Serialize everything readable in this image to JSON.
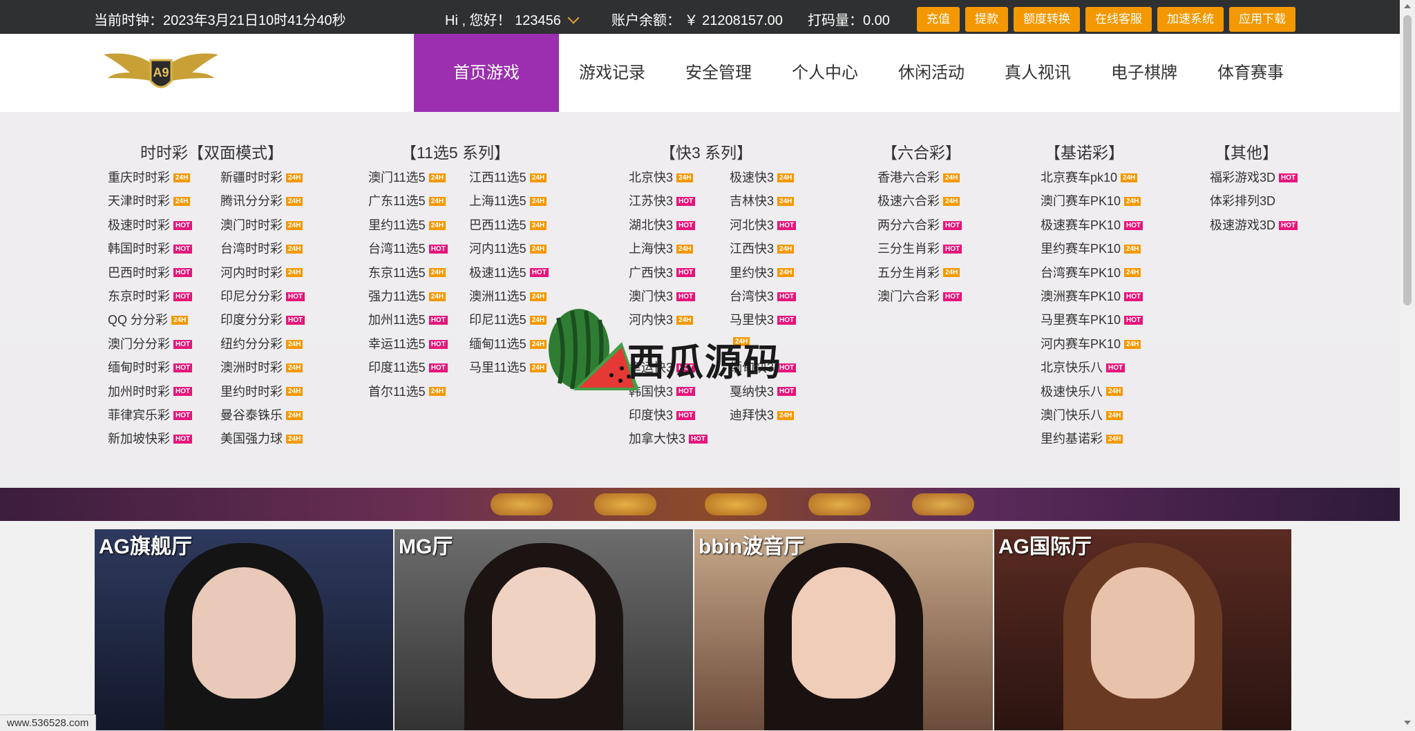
{
  "topbar": {
    "clock": "当前时钟：2023年3月21日10时41分40秒",
    "greeting": "Hi , 您好！ 123456",
    "balance": "账户余额： ￥ 21208157.00",
    "turnover": "打码量：0.00",
    "buttons": [
      "充值",
      "提款",
      "额度转换",
      "在线客服",
      "加速系统",
      "应用下载"
    ]
  },
  "nav": {
    "items": [
      "首页游戏",
      "游戏记录",
      "安全管理",
      "个人中心",
      "休闲活动",
      "真人视讯",
      "电子棋牌",
      "体育赛事"
    ],
    "active": "首页游戏"
  },
  "menu": {
    "ssc": {
      "title": "时时彩【双面模式】",
      "col1": [
        {
          "name": "重庆时时彩",
          "badge": "24H"
        },
        {
          "name": "天津时时彩",
          "badge": "24H"
        },
        {
          "name": "极速时时彩",
          "badge": "HOT"
        },
        {
          "name": "韩国时时彩",
          "badge": "HOT"
        },
        {
          "name": "巴西时时彩",
          "badge": "HOT"
        },
        {
          "name": "东京时时彩",
          "badge": "HOT"
        },
        {
          "name": "QQ 分分彩",
          "badge": "24H"
        },
        {
          "name": "澳门分分彩",
          "badge": "HOT"
        },
        {
          "name": "缅甸时时彩",
          "badge": "HOT"
        },
        {
          "name": "加州时时彩",
          "badge": "HOT"
        },
        {
          "name": "菲律宾乐彩",
          "badge": "HOT"
        },
        {
          "name": "新加坡快彩",
          "badge": "HOT"
        }
      ],
      "col2": [
        {
          "name": "新疆时时彩",
          "badge": "24H"
        },
        {
          "name": "腾讯分分彩",
          "badge": "24H"
        },
        {
          "name": "澳门时时彩",
          "badge": "24H"
        },
        {
          "name": "台湾时时彩",
          "badge": "24H"
        },
        {
          "name": "河内时时彩",
          "badge": "24H"
        },
        {
          "name": "印尼分分彩",
          "badge": "HOT"
        },
        {
          "name": "印度分分彩",
          "badge": "HOT"
        },
        {
          "name": "纽约分分彩",
          "badge": "24H"
        },
        {
          "name": "澳洲时时彩",
          "badge": "24H"
        },
        {
          "name": "里约时时彩",
          "badge": "24H"
        },
        {
          "name": "曼谷泰铢乐",
          "badge": "24H"
        },
        {
          "name": "美国强力球",
          "badge": "24H"
        }
      ]
    },
    "x115": {
      "title": "【11选5 系列】",
      "col1": [
        {
          "name": "澳门11选5",
          "badge": "24H"
        },
        {
          "name": "广东11选5",
          "badge": "24H"
        },
        {
          "name": "里约11选5",
          "badge": "24H"
        },
        {
          "name": "台湾11选5",
          "badge": "HOT"
        },
        {
          "name": "东京11选5",
          "badge": "24H"
        },
        {
          "name": "强力11选5",
          "badge": "24H"
        },
        {
          "name": "加州11选5",
          "badge": "HOT"
        },
        {
          "name": "幸运11选5",
          "badge": "HOT"
        },
        {
          "name": "印度11选5",
          "badge": "HOT"
        },
        {
          "name": "首尔11选5",
          "badge": "24H"
        }
      ],
      "col2": [
        {
          "name": "江西11选5",
          "badge": "24H"
        },
        {
          "name": "上海11选5",
          "badge": "24H"
        },
        {
          "name": "巴西11选5",
          "badge": "24H"
        },
        {
          "name": "河内11选5",
          "badge": "24H"
        },
        {
          "name": "极速11选5",
          "badge": "HOT"
        },
        {
          "name": "澳洲11选5",
          "badge": "24H"
        },
        {
          "name": "印尼11选5",
          "badge": "24H"
        },
        {
          "name": "缅甸11选5",
          "badge": "24H"
        },
        {
          "name": "马里11选5",
          "badge": "24H"
        }
      ]
    },
    "k3": {
      "title": "【快3 系列】",
      "col1": [
        {
          "name": "北京快3",
          "badge": "24H"
        },
        {
          "name": "江苏快3",
          "badge": "HOT"
        },
        {
          "name": "湖北快3",
          "badge": "HOT"
        },
        {
          "name": "上海快3",
          "badge": "24H"
        },
        {
          "name": "广西快3",
          "badge": "HOT"
        },
        {
          "name": "澳门快3",
          "badge": "HOT"
        },
        {
          "name": "河内快3",
          "badge": "24H"
        },
        {
          "name": "",
          "badge": ""
        },
        {
          "name": "幸运快3",
          "badge": "HOT"
        },
        {
          "name": "韩国快3",
          "badge": "HOT"
        },
        {
          "name": "印度快3",
          "badge": "HOT"
        },
        {
          "name": "加拿大快3",
          "badge": "HOT"
        }
      ],
      "col2": [
        {
          "name": "极速快3",
          "badge": "24H"
        },
        {
          "name": "吉林快3",
          "badge": "24H"
        },
        {
          "name": "河北快3",
          "badge": "HOT"
        },
        {
          "name": "江西快3",
          "badge": "24H"
        },
        {
          "name": "里约快3",
          "badge": "24H"
        },
        {
          "name": "台湾快3",
          "badge": "HOT"
        },
        {
          "name": "马里快3",
          "badge": "HOT"
        },
        {
          "name": "",
          "badge": "24H"
        },
        {
          "name": "缅甸快3",
          "badge": "HOT"
        },
        {
          "name": "戛纳快3",
          "badge": "HOT"
        },
        {
          "name": "迪拜快3",
          "badge": "24H"
        }
      ]
    },
    "lhc": {
      "title": "【六合彩】",
      "items": [
        {
          "name": "香港六合彩",
          "badge": "24H"
        },
        {
          "name": "极速六合彩",
          "badge": "24H"
        },
        {
          "name": "两分六合彩",
          "badge": "HOT"
        },
        {
          "name": "三分生肖彩",
          "badge": "HOT"
        },
        {
          "name": "五分生肖彩",
          "badge": "24H"
        },
        {
          "name": "澳门六合彩",
          "badge": "HOT"
        }
      ]
    },
    "keno": {
      "title": "【基诺彩】",
      "items": [
        {
          "name": "北京赛车pk10",
          "badge": "24H"
        },
        {
          "name": "澳门赛车PK10",
          "badge": "24H"
        },
        {
          "name": "极速赛车PK10",
          "badge": "HOT"
        },
        {
          "name": "里约赛车PK10",
          "badge": "24H"
        },
        {
          "name": "台湾赛车PK10",
          "badge": "24H"
        },
        {
          "name": "澳洲赛车PK10",
          "badge": "HOT"
        },
        {
          "name": "马里赛车PK10",
          "badge": "HOT"
        },
        {
          "name": "河内赛车PK10",
          "badge": "24H"
        },
        {
          "name": "北京快乐八",
          "badge": "HOT"
        },
        {
          "name": "极速快乐八",
          "badge": "24H"
        },
        {
          "name": "澳门快乐八",
          "badge": "24H"
        },
        {
          "name": "里约基诺彩",
          "badge": "24H"
        }
      ]
    },
    "other": {
      "title": "【其他】",
      "items": [
        {
          "name": "福彩游戏3D",
          "badge": "HOT"
        },
        {
          "name": "体彩排列3D",
          "badge": ""
        },
        {
          "name": "极速游戏3D",
          "badge": "HOT"
        }
      ]
    }
  },
  "watermark": "西瓜源码",
  "cards": [
    {
      "label": "AG旗舰厅"
    },
    {
      "label": "MG厅"
    },
    {
      "label": "bbin波音厅"
    },
    {
      "label": "AG国际厅"
    }
  ],
  "statusbar": "www.536528.com",
  "colors": {
    "accent": "#9b2fb0",
    "button": "#f39800",
    "hot": "#e6157a",
    "topbar": "#2f3032"
  }
}
